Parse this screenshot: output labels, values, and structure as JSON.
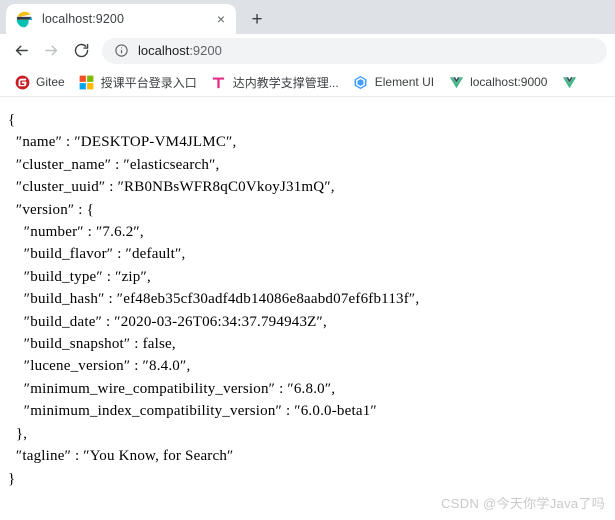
{
  "browser": {
    "tab": {
      "title": "localhost:9200",
      "favicon": "elasticsearch-logo-icon",
      "close_label": "×"
    },
    "new_tab_label": "+",
    "nav": {
      "back_label": "←",
      "forward_label": "→",
      "reload_label": "⟳"
    },
    "omnibox": {
      "site_info_icon": "info-circle-icon",
      "url_host": "localhost",
      "url_port": ":9200",
      "url_full": "localhost:9200"
    },
    "bookmarks": [
      {
        "label": "Gitee",
        "icon": "gitee-icon"
      },
      {
        "label": "授课平台登录入口",
        "icon": "microsoft-squares-icon"
      },
      {
        "label": "达内教学支撑管理...",
        "icon": "tedu-t-icon"
      },
      {
        "label": "Element UI",
        "icon": "element-ui-icon"
      },
      {
        "label": "localhost:9000",
        "icon": "vue-icon"
      },
      {
        "label": "",
        "icon": "vue-icon"
      }
    ]
  },
  "page": {
    "json_text": "{\n  ″name″ : ″DESKTOP-VM4JLMC″,\n  ″cluster_name″ : ″elasticsearch″,\n  ″cluster_uuid″ : ″RB0NBsWFR8qC0VkoyJ31mQ″,\n  ″version″ : {\n    ″number″ : ″7.6.2″,\n    ″build_flavor″ : ″default″,\n    ″build_type″ : ″zip″,\n    ″build_hash″ : ″ef48eb35cf30adf4db14086e8aabd07ef6fb113f″,\n    ″build_date″ : ″2020-03-26T06:34:37.794943Z″,\n    ″build_snapshot″ : false,\n    ″lucene_version″ : ″8.4.0″,\n    ″minimum_wire_compatibility_version″ : ″6.8.0″,\n    ″minimum_index_compatibility_version″ : ″6.0.0-beta1″\n  },\n  ″tagline″ : ″You Know, for Search″\n}",
    "watermark": "CSDN @今天你学Java了吗"
  },
  "response_data": {
    "name": "DESKTOP-VM4JLMC",
    "cluster_name": "elasticsearch",
    "cluster_uuid": "RB0NBsWFR8qC0VkoyJ31mQ",
    "version": {
      "number": "7.6.2",
      "build_flavor": "default",
      "build_type": "zip",
      "build_hash": "ef48eb35cf30adf4db14086e8aabd07ef6fb113f",
      "build_date": "2020-03-26T06:34:37.794943Z",
      "build_snapshot": false,
      "lucene_version": "8.4.0",
      "minimum_wire_compatibility_version": "6.8.0",
      "minimum_index_compatibility_version": "6.0.0-beta1"
    },
    "tagline": "You Know, for Search"
  },
  "colors": {
    "tabstrip_bg": "#dee1e6",
    "omnibox_bg": "#f1f3f4",
    "text": "#3c4043",
    "watermark": "#c9c9c9",
    "gitee_red": "#c71d23",
    "vue_green": "#41b883",
    "element_blue": "#409eff",
    "tedu_pink": "#e8308a"
  }
}
